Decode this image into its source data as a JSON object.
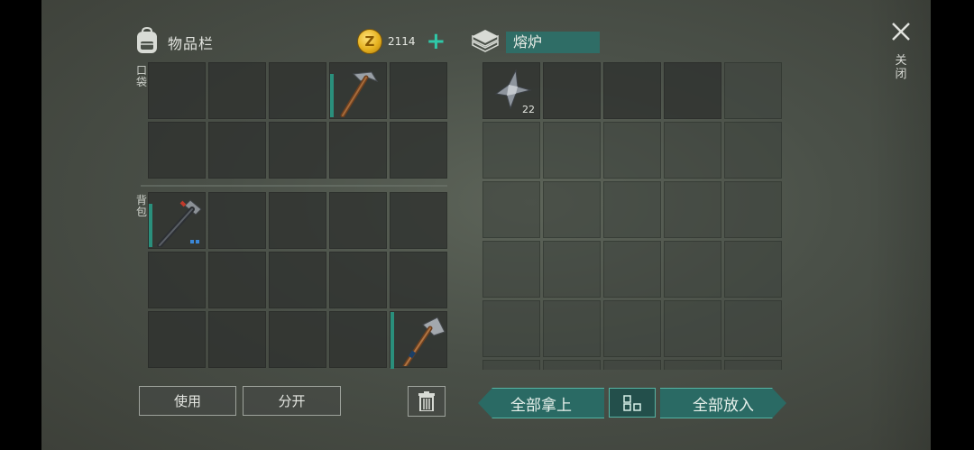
{
  "inventory": {
    "title": "物品栏",
    "pocket_label": "口袋",
    "backpack_label": "背包",
    "coin_amount": "2114",
    "coin_symbol": "Z",
    "add_coins_symbol": "+"
  },
  "furnace": {
    "title": "熔炉",
    "slot_items": [
      {
        "slot": 1,
        "icon": "metal-scrap-icon",
        "quantity": "22"
      }
    ]
  },
  "inventory_items": [
    {
      "area": "pocket",
      "slot": 4,
      "icon": "pickaxe-icon"
    },
    {
      "area": "backpack",
      "slot": 1,
      "icon": "hammer-icon"
    },
    {
      "area": "backpack",
      "slot": 15,
      "icon": "hatchet-icon"
    }
  ],
  "buttons": {
    "use": "使用",
    "split": "分开",
    "take_all": "全部拿上",
    "put_all": "全部放入",
    "close_label": "关闭"
  },
  "colors": {
    "accent_teal": "#2a6a64",
    "accent_teal_bright": "#2fc8a8",
    "equip_bar": "#2a8f7c",
    "coin_gold": "#e6b21f"
  }
}
